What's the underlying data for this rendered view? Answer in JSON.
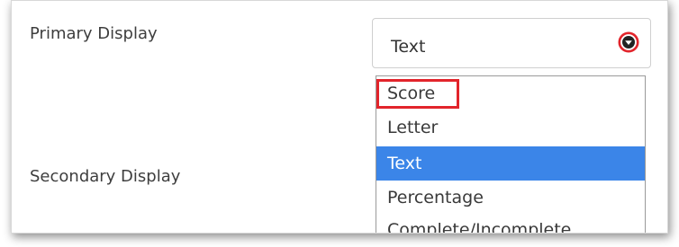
{
  "form": {
    "primary_display_label": "Primary Display",
    "secondary_display_label": "Secondary Display",
    "primary_select": {
      "value": "Text",
      "options": [
        "Score",
        "Letter",
        "Text",
        "Percentage",
        "Complete/Incomplete"
      ],
      "selected_index": 2,
      "highlighted_option": "Score"
    }
  },
  "icons": {
    "dropdown_arrow": "chevron-down-circle-icon"
  },
  "colors": {
    "selected_option_bg": "#3b85e8",
    "annotation_red": "#e2242b",
    "text": "#3a3a3a"
  }
}
